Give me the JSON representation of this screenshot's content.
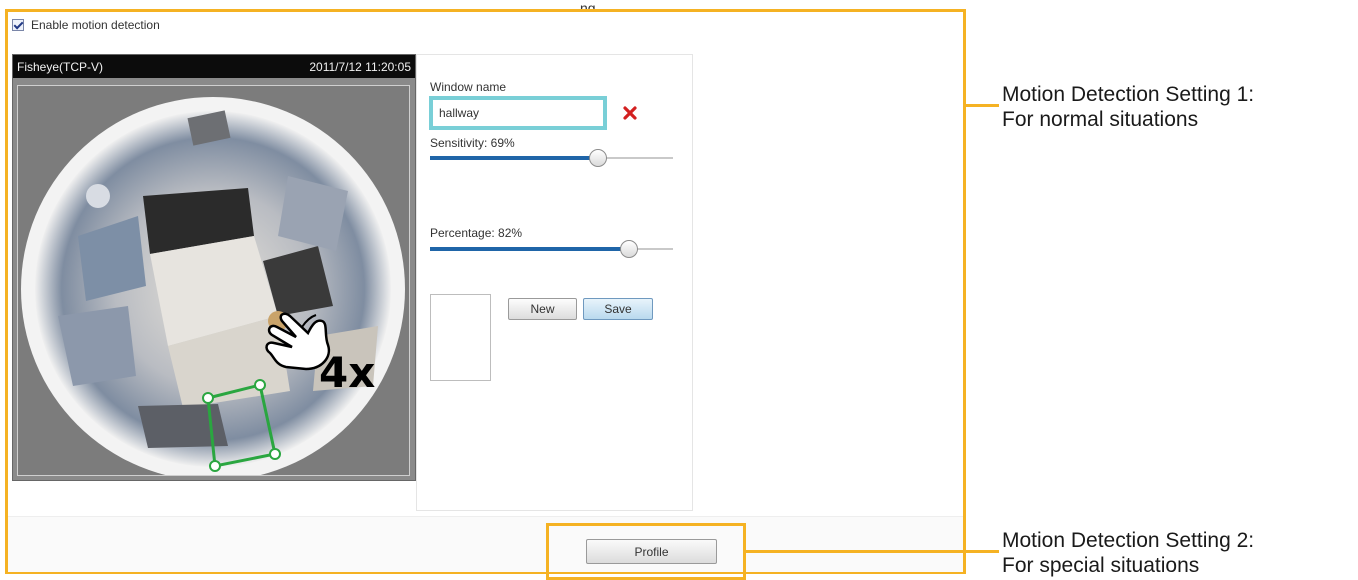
{
  "top_partial_text": "ng",
  "enable_motion": {
    "label": "Enable motion detection",
    "checked": true
  },
  "video": {
    "source_label": "Fisheye(TCP-V)",
    "timestamp": "2011/7/12 11:20:05"
  },
  "window_settings": {
    "window_name_label": "Window name",
    "window_name_value": "hallway",
    "sensitivity_label": "Sensitivity: 69%",
    "sensitivity_value": 69,
    "percentage_label": "Percentage: 82%",
    "percentage_value": 82,
    "new_button": "New",
    "save_button": "Save"
  },
  "profile_button": "Profile",
  "gesture_overlay": "4x",
  "annotations": {
    "setting1_line1": "Motion Detection Setting 1:",
    "setting1_line2": "For normal situations",
    "setting2_line1": "Motion Detection Setting 2:",
    "setting2_line2": "For special situations"
  },
  "colors": {
    "annotation_frame": "#f5b223",
    "slider_fill": "#1f65a8",
    "motion_window": "#2aa640",
    "delete": "#d32020",
    "input_border": "#79cfd7"
  },
  "icons": [
    "hand-pointer-icon",
    "delete-window-icon",
    "checkbox-checked-icon"
  ]
}
